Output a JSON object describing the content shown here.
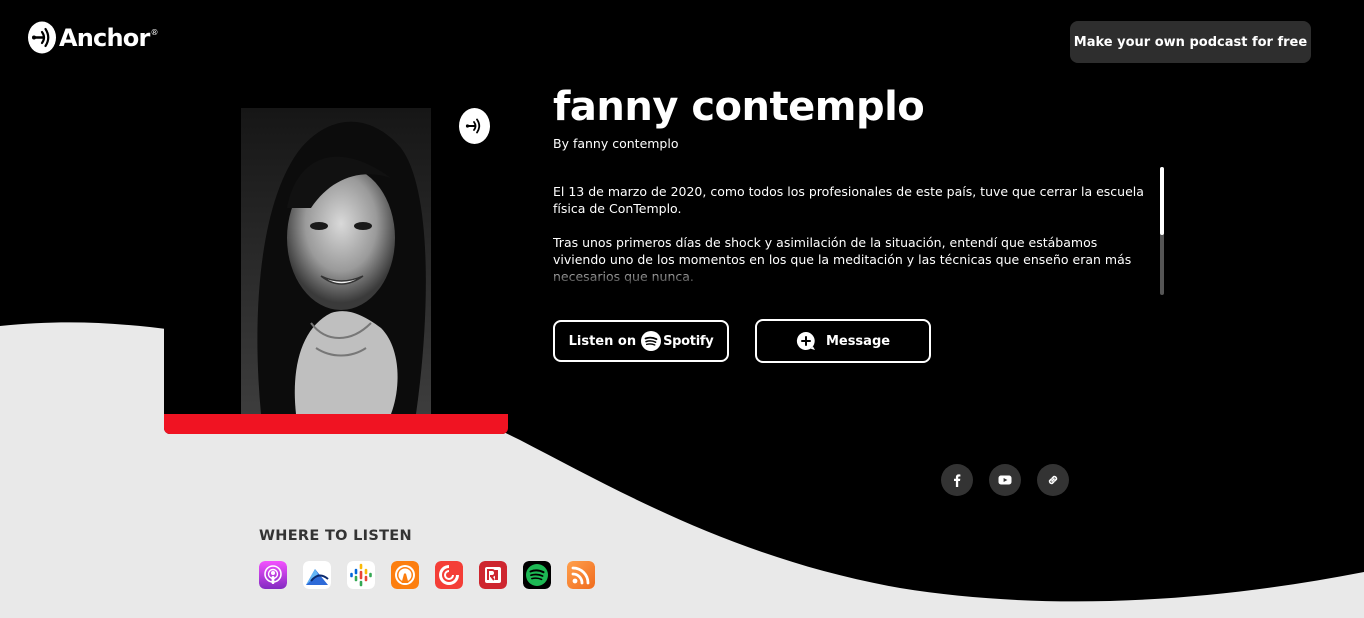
{
  "header": {
    "logo_text": "Anchor",
    "logo_reg": "®",
    "cta_label": "Make your own podcast for free"
  },
  "podcast": {
    "title": "fanny contemplo",
    "byline": "By fanny contemplo",
    "description": [
      "El 13 de marzo de 2020, como todos los profesionales de este país, tuve que cerrar la escuela física de ConTemplo.",
      "Tras unos primeros días de shock y asimilación de la situación, entendí que estábamos viviendo uno de los momentos en los que la meditación y las técnicas que enseño eran más necesarios que nunca."
    ]
  },
  "actions": {
    "listen_prefix": "Listen on",
    "spotify_label": "Spotify",
    "message_label": "Message"
  },
  "social": [
    "facebook-icon",
    "youtube-icon",
    "link-icon"
  ],
  "where_to_listen": {
    "heading": "WHERE TO LISTEN",
    "platforms": [
      "apple-podcasts",
      "breaker",
      "google-podcasts",
      "overcast",
      "pocket-casts",
      "radiopublic",
      "spotify",
      "rss"
    ]
  },
  "colors": {
    "background_dark": "#000000",
    "wave_light": "#e9e9e9",
    "accent_red": "#f01322",
    "cta_bg": "#2e2e2e",
    "spotify_green": "#1db954"
  }
}
